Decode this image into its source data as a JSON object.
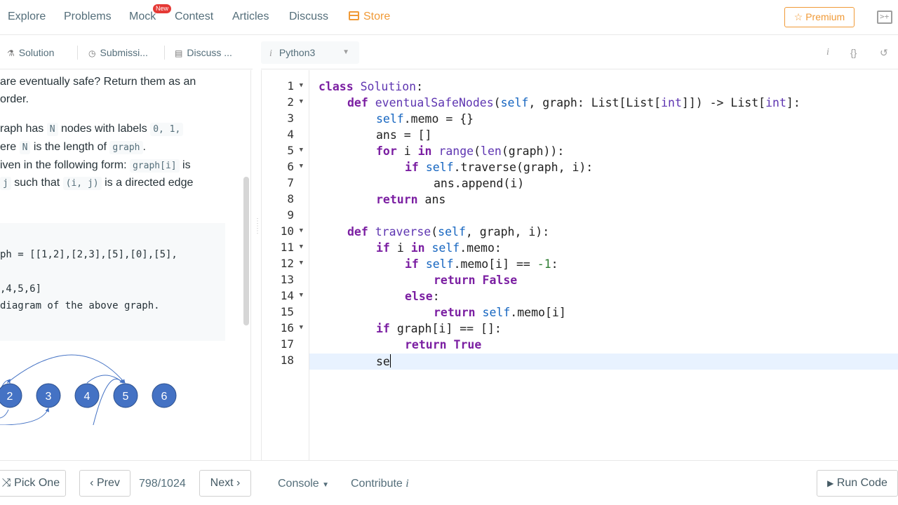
{
  "nav": {
    "items": [
      "Explore",
      "Problems",
      "Mock",
      "Contest",
      "Articles",
      "Discuss"
    ],
    "store": "Store",
    "mock_badge": "New",
    "premium": "☆ Premium"
  },
  "subtabs": {
    "solution": "Solution",
    "submissions": "Submissi...",
    "discuss": "Discuss ..."
  },
  "description": {
    "line1": "are eventually safe?  Return them as an",
    "line2": " order.",
    "line3_a": "raph has ",
    "line3_code1": "N",
    "line3_b": " nodes with labels ",
    "line3_code2": "0, 1,",
    "line4_a": "ere ",
    "line4_code1": "N",
    "line4_b": " is the length of ",
    "line4_code2": "graph",
    "line4_c": ".",
    "line5_a": "iven in the following form: ",
    "line5_code": "graph[i]",
    "line5_b": " is",
    "line6_code1": "j",
    "line6_a": " such that ",
    "line6_code2": "(i, j)",
    "line6_b": " is a directed edge",
    "example_line1": "ph = [[1,2],[2,3],[5],[0],[5],",
    "example_line2": ",4,5,6]",
    "example_line3": "diagram of the above graph.",
    "graph_nodes": [
      "2",
      "3",
      "4",
      "5",
      "6"
    ]
  },
  "editor": {
    "language": "Python3",
    "lines": [
      "1",
      "2",
      "3",
      "4",
      "5",
      "6",
      "7",
      "8",
      "9",
      "10",
      "11",
      "12",
      "13",
      "14",
      "15",
      "16",
      "17",
      "18"
    ],
    "code": {
      "l1_kw": "class ",
      "l1_name": "Solution",
      "l1_rest": ":",
      "l2_kw": "def ",
      "l2_fn": "eventualSafeNodes",
      "l2_a": "(",
      "l2_self": "self",
      "l2_b": ", graph: List[List[",
      "l2_int1": "int",
      "l2_c": "]]) -> List[",
      "l2_int2": "int",
      "l2_d": "]:",
      "l3_self": "self",
      "l3_rest": ".memo = {}",
      "l4": "ans = []",
      "l5_kw": "for ",
      "l5_a": "i ",
      "l5_kw2": "in ",
      "l5_bi1": "range",
      "l5_b": "(",
      "l5_bi2": "len",
      "l5_c": "(graph)):",
      "l6_kw": "if ",
      "l6_self": "self",
      "l6_rest": ".traverse(graph, i):",
      "l7": "ans.append(i)",
      "l8_kw": "return ",
      "l8_rest": "ans",
      "l10_kw": "def ",
      "l10_fn": "traverse",
      "l10_a": "(",
      "l10_self": "self",
      "l10_b": ", graph, i):",
      "l11_kw": "if ",
      "l11_a": "i ",
      "l11_kw2": "in ",
      "l11_self": "self",
      "l11_rest": ".memo:",
      "l12_kw": "if ",
      "l12_self": "self",
      "l12_a": ".memo[i] == ",
      "l12_num": "-1",
      "l12_b": ":",
      "l13_kw": "return ",
      "l13_val": "False",
      "l14_kw": "else",
      "l14_rest": ":",
      "l15_kw": "return ",
      "l15_self": "self",
      "l15_rest": ".memo[i]",
      "l16_kw": "if ",
      "l16_rest": "graph[i] == []:",
      "l17_kw": "return ",
      "l17_val": "True",
      "l18": "se"
    }
  },
  "bottom": {
    "pick_one": "Pick One",
    "prev": "Prev",
    "counter": "798/1024",
    "next": "Next",
    "console": "Console",
    "contribute": "Contribute",
    "run_code": "Run Code"
  }
}
